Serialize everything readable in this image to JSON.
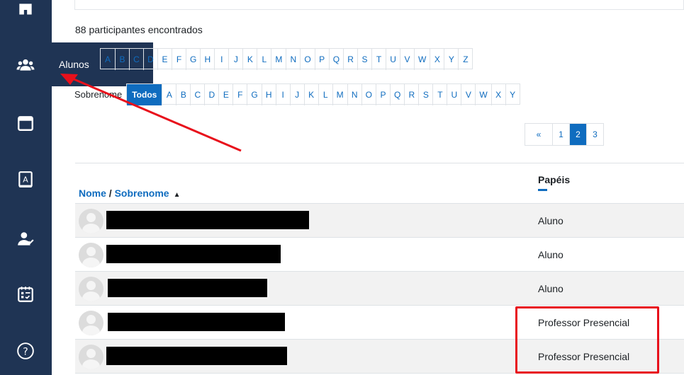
{
  "sidebar": {
    "items": [
      {
        "icon": "home-icon"
      },
      {
        "icon": "users-icon"
      },
      {
        "icon": "calendar-icon"
      },
      {
        "icon": "grades-icon"
      },
      {
        "icon": "user-check-icon"
      },
      {
        "icon": "schedule-icon"
      },
      {
        "icon": "help-icon"
      }
    ],
    "tooltip": "Alunos"
  },
  "participants": {
    "count_text": "88 participantes encontrados"
  },
  "firstname_filter": {
    "letters": [
      "A",
      "B",
      "C",
      "D",
      "E",
      "F",
      "G",
      "H",
      "I",
      "J",
      "K",
      "L",
      "M",
      "N",
      "O",
      "P",
      "Q",
      "R",
      "S",
      "T",
      "U",
      "V",
      "W",
      "X",
      "Y",
      "Z"
    ]
  },
  "lastname_filter": {
    "label": "Sobrenome",
    "all_label": "Todos",
    "letters": [
      "A",
      "B",
      "C",
      "D",
      "E",
      "F",
      "G",
      "H",
      "I",
      "J",
      "K",
      "L",
      "M",
      "N",
      "O",
      "P",
      "Q",
      "R",
      "S",
      "T",
      "U",
      "V",
      "W",
      "X",
      "Y"
    ]
  },
  "pagination": {
    "prev": "«",
    "pages": [
      "1",
      "2",
      "3"
    ],
    "active": "2"
  },
  "table": {
    "header_name": "Nome",
    "header_separator": " / ",
    "header_surname": "Sobrenome",
    "sort_indicator": "▲",
    "header_roles": "Papéis",
    "rows": [
      {
        "role": "Aluno"
      },
      {
        "role": "Aluno"
      },
      {
        "role": "Aluno"
      },
      {
        "role": "Professor Presencial"
      },
      {
        "role": "Professor Presencial"
      }
    ]
  },
  "colors": {
    "sidebar": "#1f3454",
    "accent": "#0f6cbf",
    "annotation": "#e8101b"
  }
}
